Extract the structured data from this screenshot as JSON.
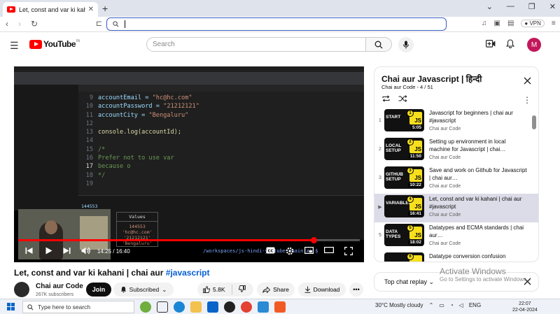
{
  "browser": {
    "tab_title": "Let, const and var ki kahani | chai",
    "new_tab": "+",
    "url": "",
    "vpn_label": "VPN"
  },
  "youtube": {
    "logo_text": "YouTube",
    "logo_country": "IN",
    "search_placeholder": "Search",
    "avatar_letter": "M"
  },
  "player": {
    "code_lines": [
      {
        "n": "9",
        "t": "accountEmail = ",
        "s": "\"hc@hc.com\"",
        "kind": "code"
      },
      {
        "n": "10",
        "t": "accountPassword = ",
        "s": "\"21212121\"",
        "kind": "code"
      },
      {
        "n": "11",
        "t": "accountCity = ",
        "s": "\"Bengaluru\"",
        "kind": "code"
      },
      {
        "n": "12",
        "t": "",
        "s": "",
        "kind": "code"
      },
      {
        "n": "13",
        "t": "console.log(accountId);",
        "s": "",
        "kind": "fn"
      },
      {
        "n": "14",
        "t": "",
        "s": "",
        "kind": "code"
      },
      {
        "n": "15",
        "t": "/*",
        "s": "",
        "kind": "cm"
      },
      {
        "n": "16",
        "t": "Prefer not to use var",
        "s": "",
        "kind": "cm"
      },
      {
        "n": "17",
        "t": "because o",
        "s": "",
        "kind": "cm"
      },
      {
        "n": "18",
        "t": "*/",
        "s": "",
        "kind": "cm"
      },
      {
        "n": "19",
        "t": "",
        "s": "",
        "kind": "code"
      }
    ],
    "active_line": "17",
    "output_number": "144553",
    "values_header": "Values",
    "values": [
      "144553",
      "'hc@hc.com'",
      "'21212121'",
      "'Bengaluru'"
    ],
    "terminal_text": "/workspaces/js-hindi-youtube (main ✗) $",
    "current_time": "14:25",
    "duration": "16:40",
    "time_display": "14:25 / 16:40",
    "progress_fraction": 0.865
  },
  "video": {
    "title_text": "Let, const and var ki kahani | chai aur ",
    "title_hashtag": "#javascript",
    "channel_name": "Chai aur Code",
    "subscribers": "267K subscribers",
    "join_label": "Join",
    "subscribed_label": "Subscribed",
    "likes": "5.8K",
    "share_label": "Share",
    "download_label": "Download"
  },
  "playlist": {
    "title": "Chai aur Javascript | हिन्दी",
    "subtitle": "Chai aur Code - 4 / 51",
    "items": [
      {
        "idx": "1",
        "thumb_text": "START",
        "num": "1",
        "duration": "5:05",
        "title": "Javascript for beginners | chai aur #javascript",
        "channel": "Chai aur Code",
        "active": false
      },
      {
        "idx": "2",
        "thumb_text": "LOCAL SETUP",
        "num": "2",
        "duration": "11:50",
        "title": "Setting up environment in local machine for Javascript | chai…",
        "channel": "Chai aur Code",
        "active": false
      },
      {
        "idx": "3",
        "thumb_text": "GITHUB SETUP",
        "num": "3",
        "duration": "10:22",
        "title": "Save and work on Github for Javascript | chai aur…",
        "channel": "Chai aur Code",
        "active": false
      },
      {
        "idx": "▶",
        "thumb_text": "VARIABLES",
        "num": "4",
        "duration": "16:41",
        "title": "Let, const and var ki kahani | chai aur #javascript",
        "channel": "Chai aur Code",
        "active": true
      },
      {
        "idx": "5",
        "thumb_text": "DATA TYPES",
        "num": "5",
        "duration": "18:02",
        "title": "Datatypes and ECMA standards | chai aur…",
        "channel": "Chai aur Code",
        "active": false
      },
      {
        "idx": "6",
        "thumb_text": "",
        "num": "6",
        "duration": "",
        "title": "Datatype conversion confusion",
        "channel": "",
        "active": false
      }
    ]
  },
  "chat": {
    "label": "Top chat replay",
    "watermark_title": "Activate Windows",
    "watermark_sub": "Go to Settings to activate Windows."
  },
  "taskbar": {
    "search_placeholder": "Type here to search",
    "weather": "30°C  Mostly cloudy",
    "language": "ENG",
    "time": "22:07",
    "date": "22-04-2024"
  },
  "colors": {
    "yt_red": "#ff0000",
    "accent_blue": "#065fd4",
    "active_row": "#dcdce8"
  }
}
